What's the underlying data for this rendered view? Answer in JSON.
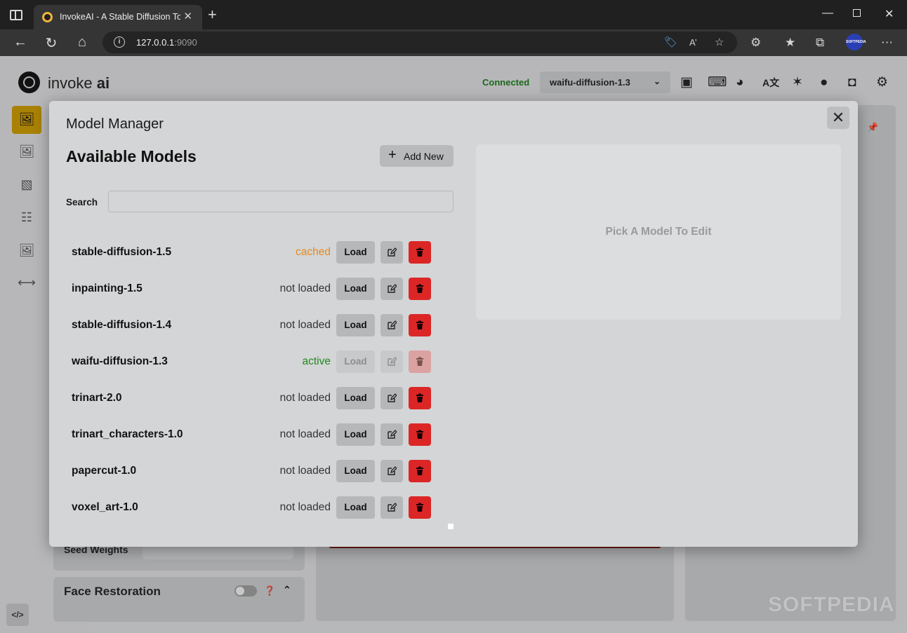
{
  "browser": {
    "tab_title": "InvokeAI - A Stable Diffusion Toolkit",
    "tab_close": "✕",
    "new_tab": "+",
    "url_host": "127.0.0.1",
    "url_port": ":9090",
    "profile_label": "SOFTPEDIA"
  },
  "header": {
    "logo_text": "invoke",
    "logo_bold": "ai",
    "connection_status": "Connected",
    "selected_model": "waifu-diffusion-1.3"
  },
  "background": {
    "seed_weights_label": "Seed Weights",
    "face_restoration_label": "Face Restoration",
    "watermark": "SOFTPEDIA"
  },
  "modal": {
    "title": "Model Manager",
    "section_title": "Available Models",
    "add_new_label": "Add New",
    "search_label": "Search",
    "search_value": "",
    "empty_edit_message": "Pick A Model To Edit",
    "close_label": "✕",
    "models": [
      {
        "name": "stable-diffusion-1.5",
        "status": "cached",
        "load_label": "Load"
      },
      {
        "name": "inpainting-1.5",
        "status": "not loaded",
        "load_label": "Load"
      },
      {
        "name": "stable-diffusion-1.4",
        "status": "not loaded",
        "load_label": "Load"
      },
      {
        "name": "waifu-diffusion-1.3",
        "status": "active",
        "load_label": "Load"
      },
      {
        "name": "trinart-2.0",
        "status": "not loaded",
        "load_label": "Load"
      },
      {
        "name": "trinart_characters-1.0",
        "status": "not loaded",
        "load_label": "Load"
      },
      {
        "name": "papercut-1.0",
        "status": "not loaded",
        "load_label": "Load"
      },
      {
        "name": "voxel_art-1.0",
        "status": "not loaded",
        "load_label": "Load"
      }
    ]
  },
  "colors": {
    "accent": "#c99800",
    "connected": "#1c7a1c",
    "cached": "#e58a1a",
    "active": "#22881f",
    "delete": "#dc2626"
  }
}
